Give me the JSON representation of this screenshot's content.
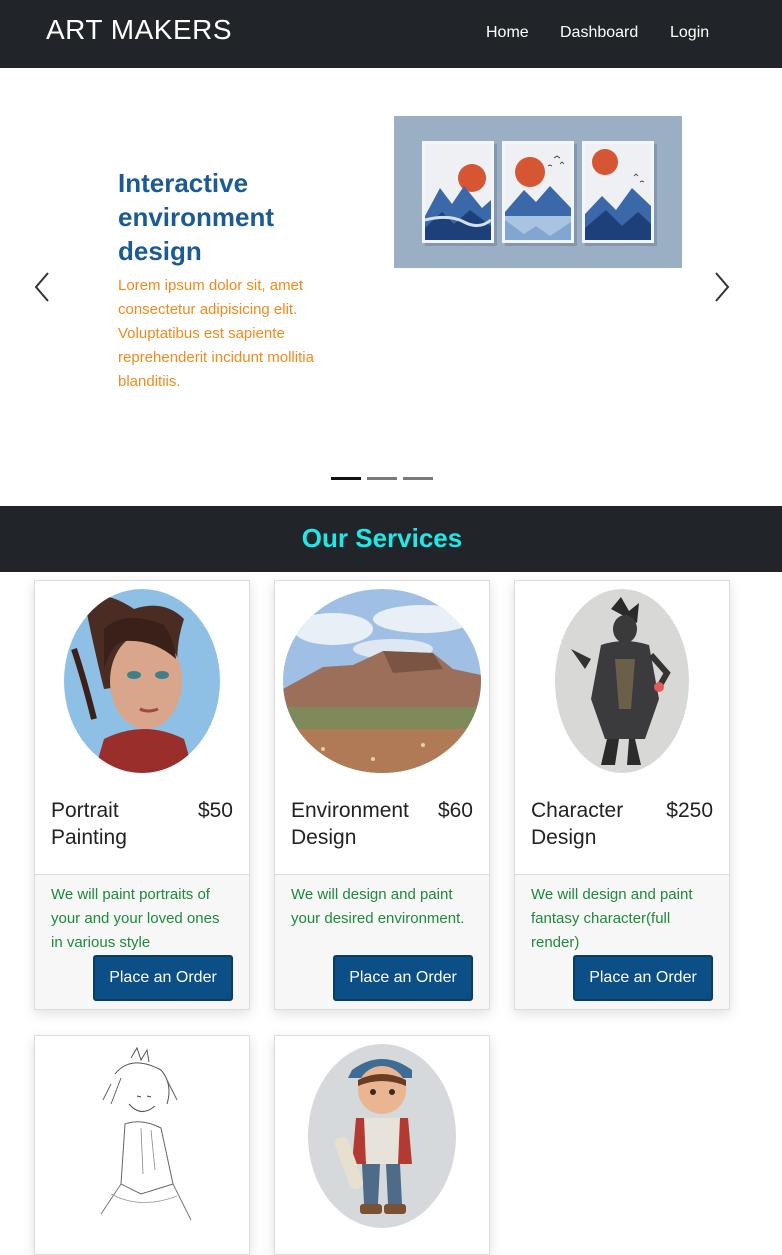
{
  "navbar": {
    "brand": "ART MAKERS",
    "links": {
      "home": "Home",
      "dashboard": "Dashboard",
      "login": "Login"
    }
  },
  "carousel": {
    "title": "Interactive environment design",
    "text": "Lorem ipsum dolor sit, amet consectetur adipisicing elit. Voluptatibus est sapiente reprehenderit incidunt mollitia blanditiis.",
    "active_slide": 0,
    "slide_count": 3
  },
  "services": {
    "heading": "Our Services",
    "cards": [
      {
        "name": "Portrait Painting",
        "price": "$50",
        "description": "We will paint portraits of your and your loved ones in various style",
        "button": "Place an Order"
      },
      {
        "name": "Environment Design",
        "price": "$60",
        "description": "We will design and paint your desired environment.",
        "button": "Place an Order"
      },
      {
        "name": "Character Design",
        "price": "$250",
        "description": "We will design and paint fantasy character(full render)",
        "button": "Place an Order"
      }
    ]
  },
  "colors": {
    "navbar_bg": "#212529",
    "slide_title": "#1b5a94",
    "slide_text": "#f08a1c",
    "services_heading": "#1ee8e8",
    "card_description": "#1e8a3b",
    "button_bg": "#0b4f86"
  }
}
